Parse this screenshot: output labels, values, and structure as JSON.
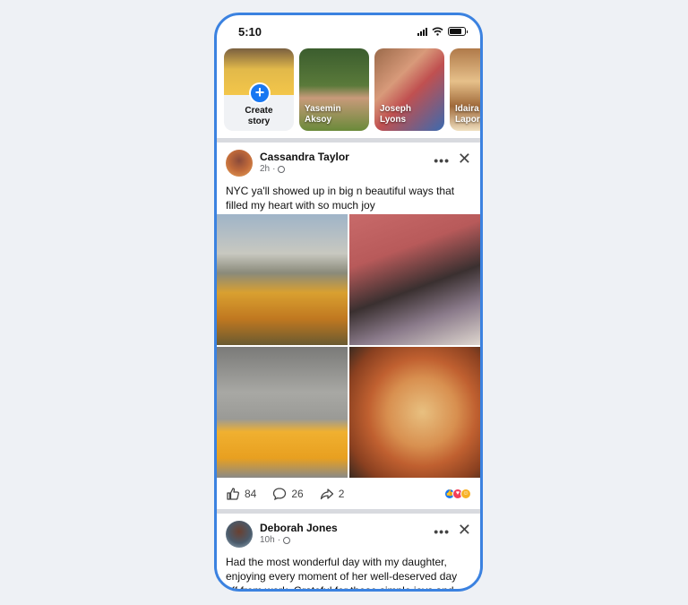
{
  "status_bar": {
    "time": "5:10"
  },
  "stories": {
    "create_label_line1": "Create",
    "create_label_line2": "story",
    "items": [
      {
        "name_line1": "Yasemin",
        "name_line2": "Aksoy"
      },
      {
        "name_line1": "Joseph",
        "name_line2": "Lyons"
      },
      {
        "name_line1": "Idaira",
        "name_line2": "Laporte"
      }
    ]
  },
  "posts": [
    {
      "author": "Cassandra Taylor",
      "time": "2h",
      "text": "NYC ya'll showed up in big n beautiful ways that filled my heart with so much joy",
      "likes": "84",
      "comments": "26",
      "shares": "2"
    },
    {
      "author": "Deborah Jones",
      "time": "10h",
      "text": "Had the most wonderful day with my daughter, enjoying every moment of her well-deserved day off from work. Grateful for these simple joys and"
    }
  ],
  "icons": {
    "more": "more-icon",
    "close": "close-icon",
    "like": "thumbs-up-icon",
    "comment": "comment-icon",
    "share": "share-icon",
    "globe": "globe-icon"
  },
  "colors": {
    "accent": "#1877f2",
    "phone_frame": "#3b82e0",
    "background": "#eef1f5"
  }
}
